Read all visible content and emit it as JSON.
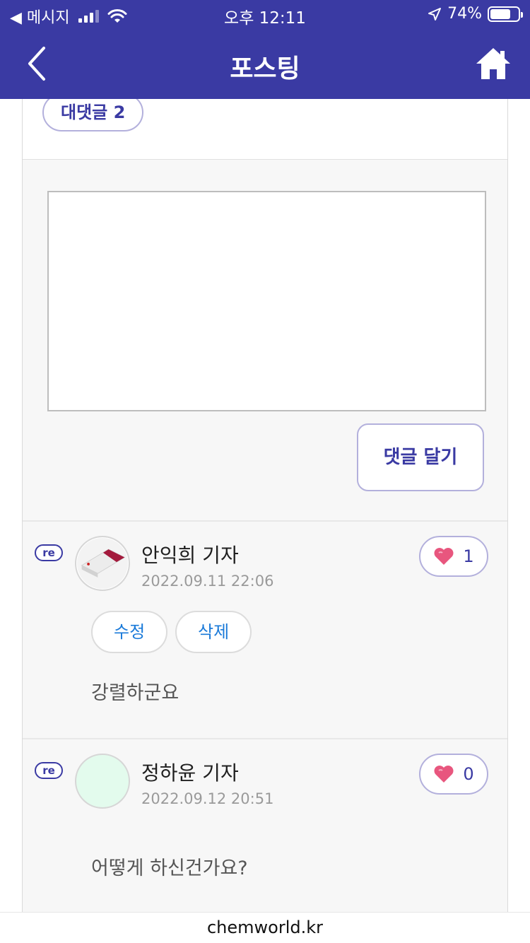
{
  "status_bar": {
    "back_app": "◀ 메시지",
    "time": "오후 12:11",
    "battery": "74%"
  },
  "header": {
    "title": "포스팅"
  },
  "reply_toggle": {
    "label": "대댓글 2"
  },
  "comment_form": {
    "textarea_value": "",
    "submit_label": "댓글 달기"
  },
  "replies": [
    {
      "badge": "re",
      "author": "안익희 기자",
      "date": "2022.09.11 22:06",
      "likes": "1",
      "actions": {
        "edit": "수정",
        "delete": "삭제"
      },
      "text": "강렬하군요"
    },
    {
      "badge": "re",
      "author": "정하윤 기자",
      "date": "2022.09.12 20:51",
      "likes": "0",
      "text": "어떻게 하신건가요?"
    }
  ],
  "footer": {
    "domain": "chemworld.kr"
  },
  "colors": {
    "primary": "#3a3aa3",
    "border_accent": "#b3b0dc",
    "action_text": "#1a7ad9",
    "heart": "#e8567e"
  }
}
